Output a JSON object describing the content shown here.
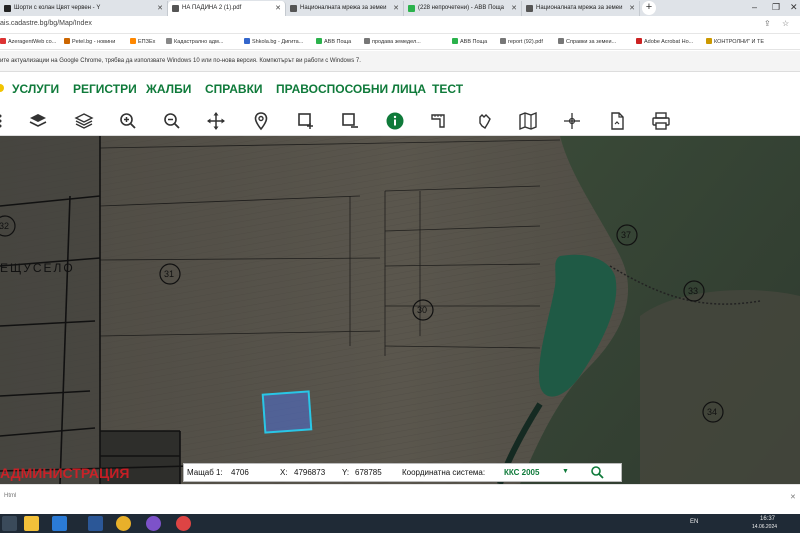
{
  "browser": {
    "tabs": [
      {
        "label": "Шорти с колан Цвят червен - Y",
        "active": false,
        "favicon_color": "#222222"
      },
      {
        "label": "НА ПАДИНА 2 (1).pdf",
        "active": true,
        "favicon_color": "#555555"
      },
      {
        "label": "Националната мрежа за земеи",
        "active": false,
        "favicon_color": "#555555"
      },
      {
        "label": "(228 непрочетени) - ABB Поща",
        "active": false,
        "favicon_color": "#2bb24c"
      },
      {
        "label": "Националната мрежа за земеи",
        "active": false,
        "favicon_color": "#555555"
      }
    ],
    "new_tab_label": "+",
    "address": "ais.cadastre.bg/bg/Map/Index",
    "bookmarks": [
      {
        "label": "AzeragentWeb со...",
        "color": "#d33"
      },
      {
        "label": "Petel.bg - новини",
        "color": "#c60"
      },
      {
        "label": "ЕПЗЕх",
        "color": "#f80"
      },
      {
        "label": "Кадастрално адм...",
        "color": "#888"
      },
      {
        "label": "Shkola.bg - Дигита...",
        "color": "#36c"
      },
      {
        "label": "ABB Поща",
        "color": "#2bb24c"
      },
      {
        "label": "продава земедел...",
        "color": "#777"
      },
      {
        "label": "ABB Поща",
        "color": "#2bb24c"
      },
      {
        "label": "report (92).pdf",
        "color": "#777"
      },
      {
        "label": "Справки за земеи...",
        "color": "#777"
      },
      {
        "label": "Adobe Acrobat Ho...",
        "color": "#c22"
      },
      {
        "label": "КОНТРОЛНИ\" И ТЕ",
        "color": "#c90"
      }
    ],
    "warning": "ите актуализации на Google Chrome, трябва да използвате Windows 10 или по-нова версия. Компютърът ви работи с Windows 7.",
    "page_bottom_left": "Html"
  },
  "site": {
    "nav": [
      "УСЛУГИ",
      "РЕГИСТРИ",
      "ЖАЛБИ",
      "СПРАВКИ",
      "ПРАВОСПОСОБНИ ЛИЦА",
      "ТЕСТ"
    ],
    "accent_color": "#0f7a3a"
  },
  "tools": [
    "layers-icon",
    "layers-outline-icon",
    "zoom-in-icon",
    "zoom-out-icon",
    "pan-icon",
    "location-pin-icon",
    "select-add-icon",
    "select-remove-icon",
    "info-icon",
    "measure-icon",
    "hand-icon",
    "map-icon",
    "crosshair-icon",
    "document-icon",
    "print-icon"
  ],
  "map": {
    "parcels": [
      "32",
      "31",
      "30",
      "37",
      "33",
      "34"
    ],
    "place_label": "ЕЩУСЕЛО",
    "watermark": "АДМИНИСТРАЦИЯ"
  },
  "status": {
    "scale_label": "Мащаб 1:",
    "scale_value": "4706",
    "x_label": "X:",
    "x_value": "4796873",
    "y_label": "Y:",
    "y_value": "678785",
    "crs_label": "Координатна система:",
    "crs_value": "ККС 2005"
  },
  "taskbar": {
    "lang": "EN",
    "time": "16:37",
    "date": "14.06.2024"
  }
}
